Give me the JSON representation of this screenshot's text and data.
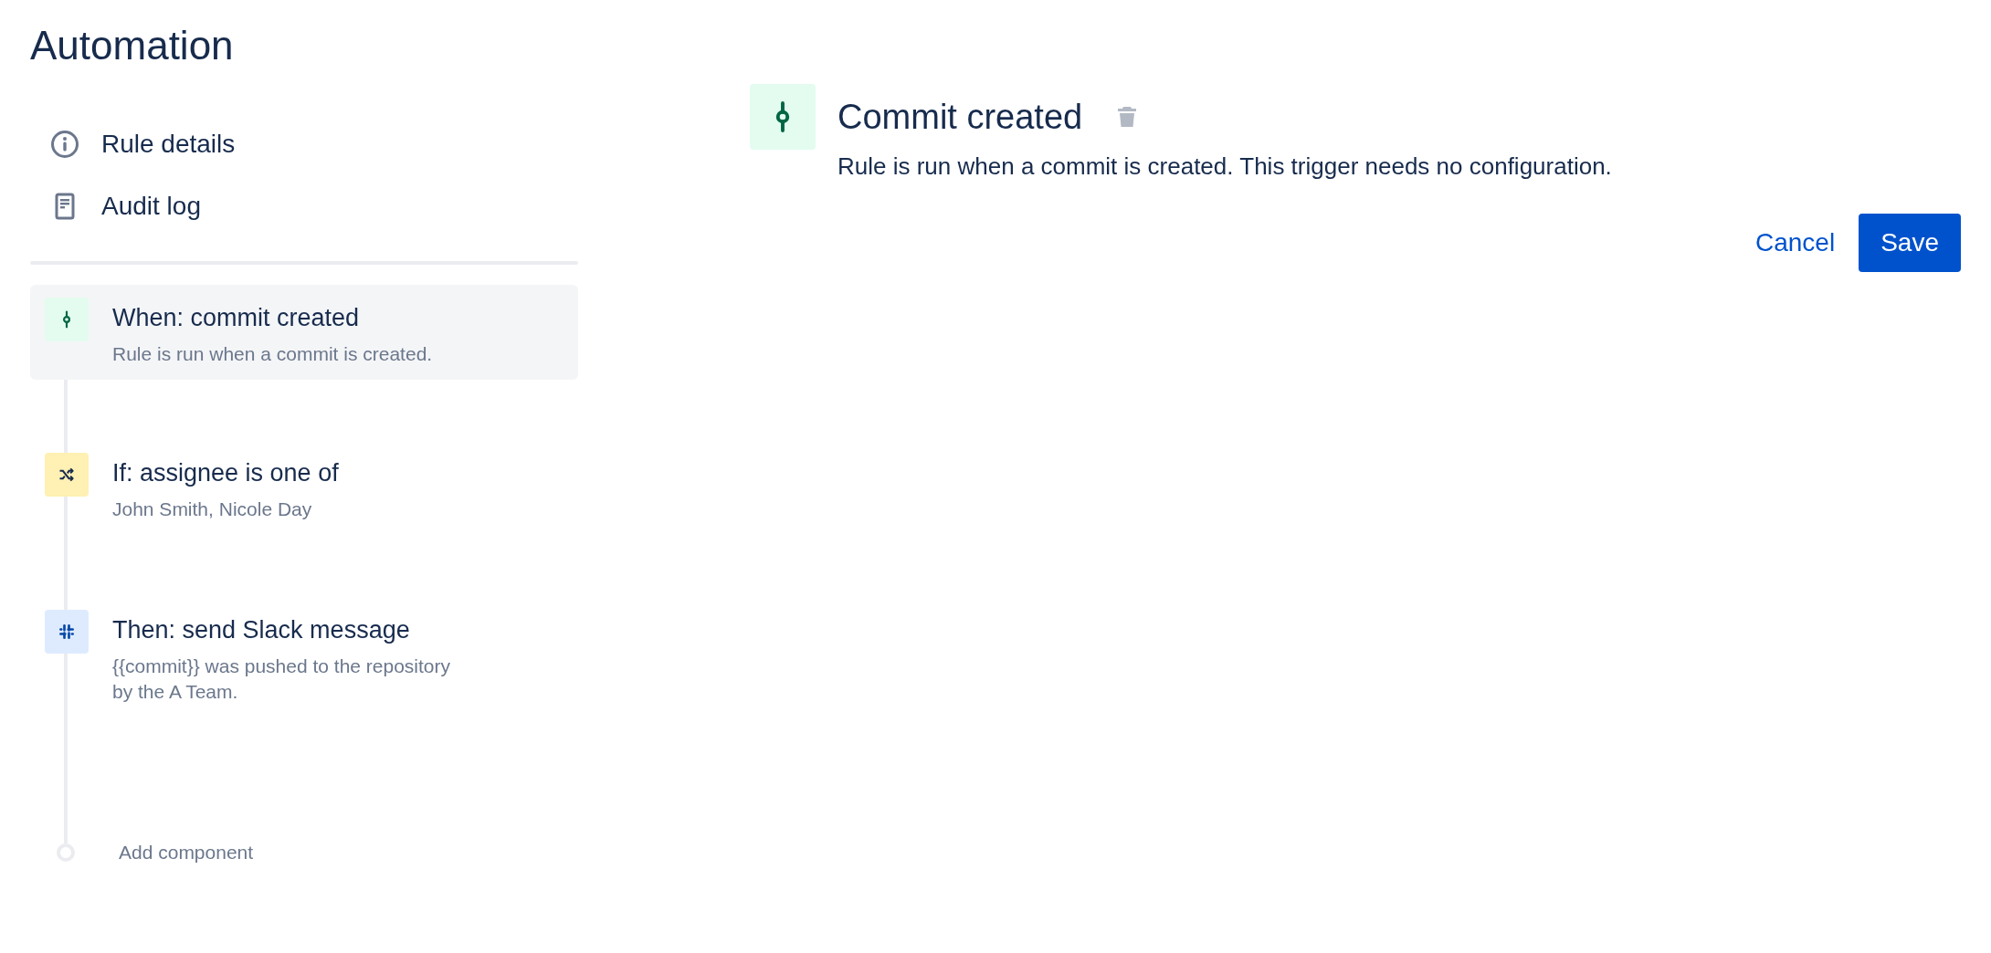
{
  "page": {
    "title": "Automation"
  },
  "nav": [
    {
      "kind": "info",
      "label": "Rule details"
    },
    {
      "kind": "log",
      "label": "Audit log"
    }
  ],
  "steps": [
    {
      "kind": "trigger",
      "title": "When: commit created",
      "description": "Rule is run when a commit is created.",
      "selected": true
    },
    {
      "kind": "condition",
      "title": "If: assignee is one of",
      "description": "John Smith, Nicole Day",
      "selected": false
    },
    {
      "kind": "action",
      "title": "Then: send Slack message",
      "description": "{{commit}} was pushed to the repository\nby the A Team.",
      "selected": false
    }
  ],
  "add_component": "Add component",
  "detail": {
    "kind": "trigger",
    "title": "Commit created",
    "description": "Rule is run when a commit is created. This trigger needs no configuration."
  },
  "actions": {
    "cancel": "Cancel",
    "save": "Save"
  }
}
